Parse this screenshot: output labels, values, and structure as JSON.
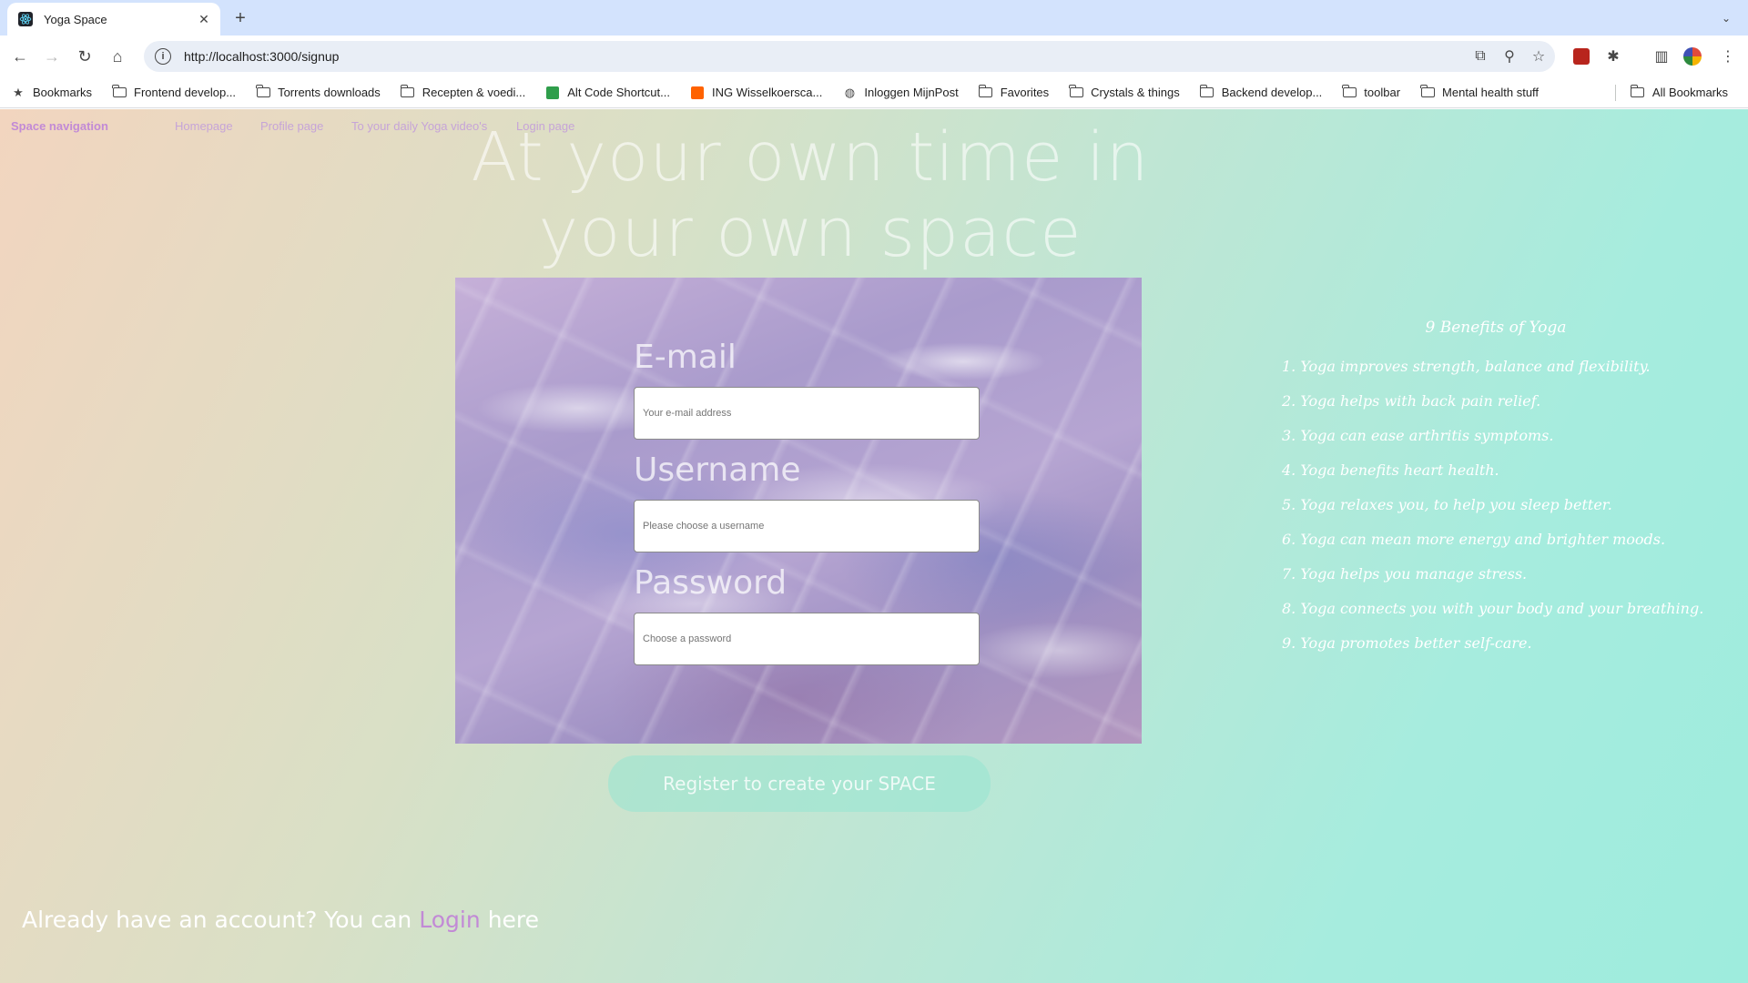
{
  "browser": {
    "tab_title": "Yoga Space",
    "url": "http://localhost:3000/signup",
    "bookmarks": [
      {
        "label": "Bookmarks",
        "icon": "star-icon"
      },
      {
        "label": "Frontend develop...",
        "icon": "folder-icon"
      },
      {
        "label": "Torrents downloads",
        "icon": "folder-icon"
      },
      {
        "label": "Recepten & voedi...",
        "icon": "folder-icon"
      },
      {
        "label": "Alt Code Shortcut...",
        "icon": "site-icon"
      },
      {
        "label": "ING Wisselkoersca...",
        "icon": "site-icon"
      },
      {
        "label": "Inloggen MijnPost",
        "icon": "site-icon"
      },
      {
        "label": "Favorites",
        "icon": "folder-icon"
      },
      {
        "label": "Crystals & things",
        "icon": "folder-icon"
      },
      {
        "label": "Backend develop...",
        "icon": "folder-icon"
      },
      {
        "label": "toolbar",
        "icon": "folder-icon"
      },
      {
        "label": "Mental health stuff",
        "icon": "folder-icon"
      }
    ],
    "all_bookmarks": "All Bookmarks"
  },
  "nav": {
    "brand": "Space navigation",
    "links": [
      "Homepage",
      "Profile page",
      "To your daily Yoga video's",
      "Login page"
    ]
  },
  "headline": "At your own time in your own space",
  "form": {
    "email_label": "E-mail",
    "email_placeholder": "Your e-mail address",
    "username_label": "Username",
    "username_placeholder": "Please choose a username",
    "password_label": "Password",
    "password_placeholder": "Choose a password",
    "submit_label": "Register to create your SPACE"
  },
  "benefits": {
    "title": "9 Benefits of Yoga",
    "items": [
      "1. Yoga improves strength, balance and flexibility.",
      "2. Yoga helps with back pain relief.",
      "3. Yoga can ease arthritis symptoms.",
      "4. Yoga benefits heart health.",
      "5. Yoga relaxes you, to help you sleep better.",
      "6. Yoga can mean more energy and brighter moods.",
      "7. Yoga helps you manage stress.",
      "8. Yoga connects you with your body and your breathing.",
      "9. Yoga promotes better self-care."
    ]
  },
  "login_prompt": {
    "before": "Already have an account? You can",
    "link": "Login",
    "after": "here"
  }
}
